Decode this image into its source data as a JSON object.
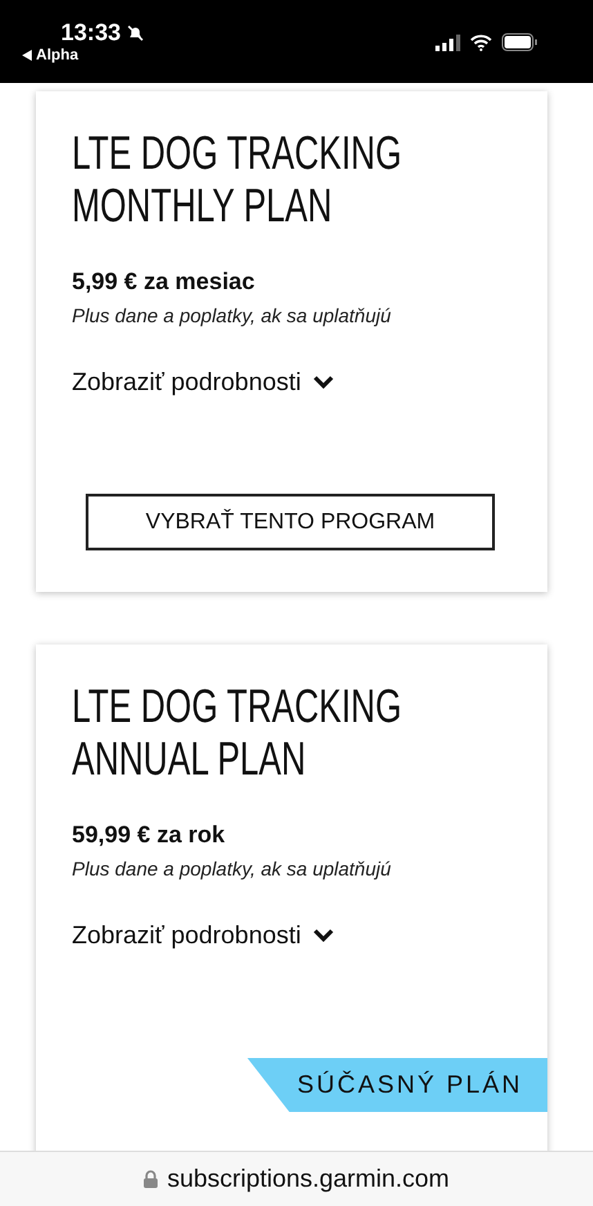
{
  "status_bar": {
    "time": "13:33",
    "back_label": "Alpha"
  },
  "plans": [
    {
      "title": "LTE DOG TRACKING MONTHLY PLAN",
      "price": "5,99 € za mesiac",
      "tax_note": "Plus dane a poplatky, ak sa uplatňujú",
      "details_link": "Zobraziť podrobnosti",
      "button": "VYBRAŤ TENTO PROGRAM"
    },
    {
      "title": "LTE DOG TRACKING ANNUAL PLAN",
      "price": "59,99 € za rok",
      "tax_note": "Plus dane a poplatky, ak sa uplatňujú",
      "details_link": "Zobraziť podrobnosti",
      "badge": "SÚČASNÝ PLÁN"
    }
  ],
  "address_bar": {
    "url": "subscriptions.garmin.com"
  }
}
